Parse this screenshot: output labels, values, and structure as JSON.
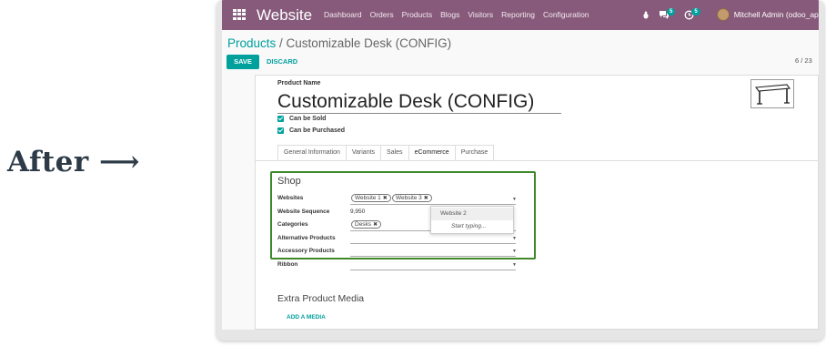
{
  "caption": {
    "text": "After",
    "arrow": "⟶"
  },
  "navbar": {
    "brand": "Website",
    "menu": [
      "Dashboard",
      "Orders",
      "Products",
      "Blogs",
      "Visitors",
      "Reporting",
      "Configuration"
    ],
    "chat_badge": "5",
    "activity_badge": "5",
    "user": "Mitchell Admin (odoo_apps_test)",
    "color": "#875a7b"
  },
  "breadcrumb": {
    "parent": "Products",
    "separator": " / ",
    "current": "Customizable Desk (CONFIG)"
  },
  "actions": {
    "save": "SAVE",
    "discard": "DISCARD"
  },
  "pager": "6 / 23",
  "form": {
    "name_label": "Product Name",
    "name": "Customizable Desk (CONFIG)",
    "can_be_sold": {
      "label": "Can be Sold",
      "checked": true
    },
    "can_be_purchased": {
      "label": "Can be Purchased",
      "checked": true
    },
    "tabs": [
      "General Information",
      "Variants",
      "Sales",
      "eCommerce",
      "Purchase"
    ],
    "active_tab": "eCommerce",
    "shop": {
      "title": "Shop",
      "websites_label": "Websites",
      "websites_tags": [
        "Website 1",
        "Website 3"
      ],
      "sequence_label": "Website Sequence",
      "sequence_value": "9,950",
      "categories_label": "Categories",
      "categories_tags": [
        "Desks"
      ],
      "alternative_label": "Alternative Products",
      "accessory_label": "Accessory Products",
      "ribbon_label": "Ribbon"
    },
    "dropdown": {
      "option": "Website 2",
      "hint": "Start typing..."
    },
    "media": {
      "title": "Extra Product Media",
      "add": "ADD A MEDIA"
    }
  },
  "colors": {
    "accent": "#00a09d",
    "highlight_border": "#3e8a2a"
  }
}
